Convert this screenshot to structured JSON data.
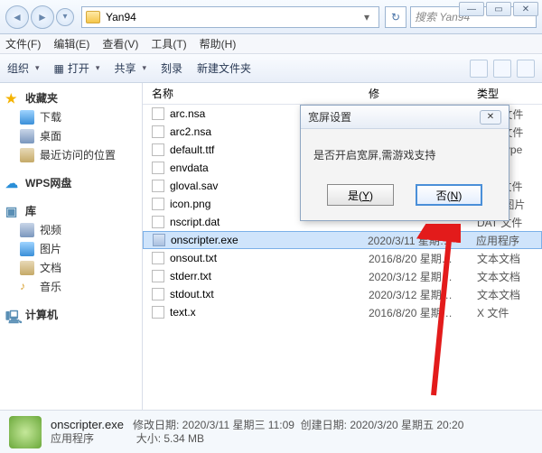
{
  "path": {
    "folder": "Yan94"
  },
  "search": {
    "placeholder": "搜索 Yan94"
  },
  "menu": {
    "file": "文件(F)",
    "edit": "编辑(E)",
    "view": "查看(V)",
    "tools": "工具(T)",
    "help": "帮助(H)"
  },
  "toolbar": {
    "organize": "组织",
    "open": "打开",
    "share": "共享",
    "burn": "刻录",
    "newfolder": "新建文件夹"
  },
  "columns": {
    "name": "名称",
    "date": "修",
    "type": "类型"
  },
  "sidebar": {
    "favorites": "收藏夹",
    "downloads": "下载",
    "desktop": "桌面",
    "recent": "最近访问的位置",
    "wps": "WPS网盘",
    "libraries": "库",
    "video": "视频",
    "pictures": "图片",
    "documents": "文档",
    "music": "音乐",
    "computer": "计算机"
  },
  "files": [
    {
      "name": "arc.nsa",
      "date": "",
      "type": "NSA 文件"
    },
    {
      "name": "arc2.nsa",
      "date": "",
      "type": "NSA 文件"
    },
    {
      "name": "default.ttf",
      "date": "",
      "type": "TrueType"
    },
    {
      "name": "envdata",
      "date": "",
      "type": "文件"
    },
    {
      "name": "gloval.sav",
      "date": "",
      "type": "SAV 文件"
    },
    {
      "name": "icon.png",
      "date": "",
      "type": "PNG 图片"
    },
    {
      "name": "nscript.dat",
      "date": "",
      "type": "DAT 文件"
    },
    {
      "name": "onscripter.exe",
      "date": "2020/3/11 星期…",
      "type": "应用程序",
      "exe": true,
      "selected": true
    },
    {
      "name": "onsout.txt",
      "date": "2016/8/20 星期…",
      "type": "文本文档"
    },
    {
      "name": "stderr.txt",
      "date": "2020/3/12 星期…",
      "type": "文本文档"
    },
    {
      "name": "stdout.txt",
      "date": "2020/3/12 星期…",
      "type": "文本文档"
    },
    {
      "name": "text.x",
      "date": "2016/8/20 星期…",
      "type": "X 文件"
    }
  ],
  "details": {
    "title": "onscripter.exe",
    "line1_a": "修改日期:",
    "line1_b": "2020/3/11 星期三 11:09",
    "line1_c": "创建日期:",
    "line1_d": "2020/3/20 星期五 20:20",
    "line2_a": "应用程序",
    "line2_b": "大小: 5.34 MB"
  },
  "dialog": {
    "title": "宽屏设置",
    "message": "是否开启宽屏,需游戏支持",
    "yes": "是(Y)",
    "no": "否(N)"
  }
}
